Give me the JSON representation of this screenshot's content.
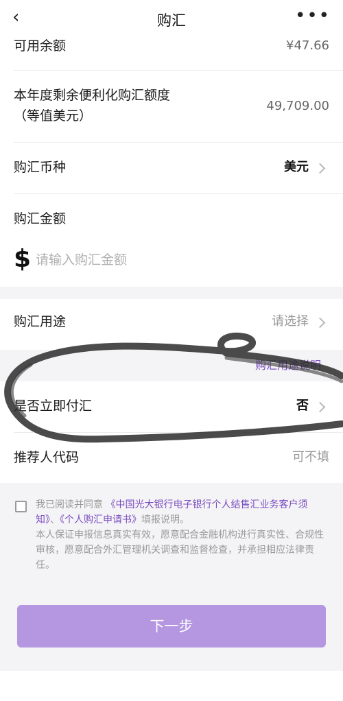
{
  "nav": {
    "title": "购汇",
    "back_icon": "‹",
    "more_icon": "•••"
  },
  "rows": {
    "available": {
      "label": "可用余额",
      "value": "¥47.66"
    },
    "quota": {
      "label_line1": "本年度剩余便利化购汇额度",
      "label_line2": "（等值美元）",
      "value": "49,709.00"
    },
    "currency": {
      "label": "购汇币种",
      "value": "美元"
    },
    "amount": {
      "label": "购汇金额",
      "currency_symbol": "$",
      "placeholder": "请输入购汇金额",
      "value": ""
    },
    "purpose": {
      "label": "购汇用途",
      "value": "请选择",
      "help_link": "购汇用途说明"
    },
    "immediate": {
      "label": "是否立即付汇",
      "value": "否"
    },
    "referrer": {
      "label": "推荐人代码",
      "value": "可不填"
    }
  },
  "agreement": {
    "prefix": "我已阅读并同意",
    "link1": "《中国光大银行电子银行个人结售汇业务客户须知》",
    "sep": "、",
    "link2": "《个人购汇申请书》",
    "suffix": "填报说明。",
    "body": "本人保证申报信息真实有效，愿意配合金融机构进行真实性、合规性审核，愿意配合外汇管理机关调查和监督检查，并承担相应法律责任。",
    "checked": false
  },
  "next_button": {
    "label": "下一步"
  },
  "colors": {
    "accent": "#7a4bc0",
    "button": "#b497e0",
    "annotation": "#2b2b2b"
  }
}
